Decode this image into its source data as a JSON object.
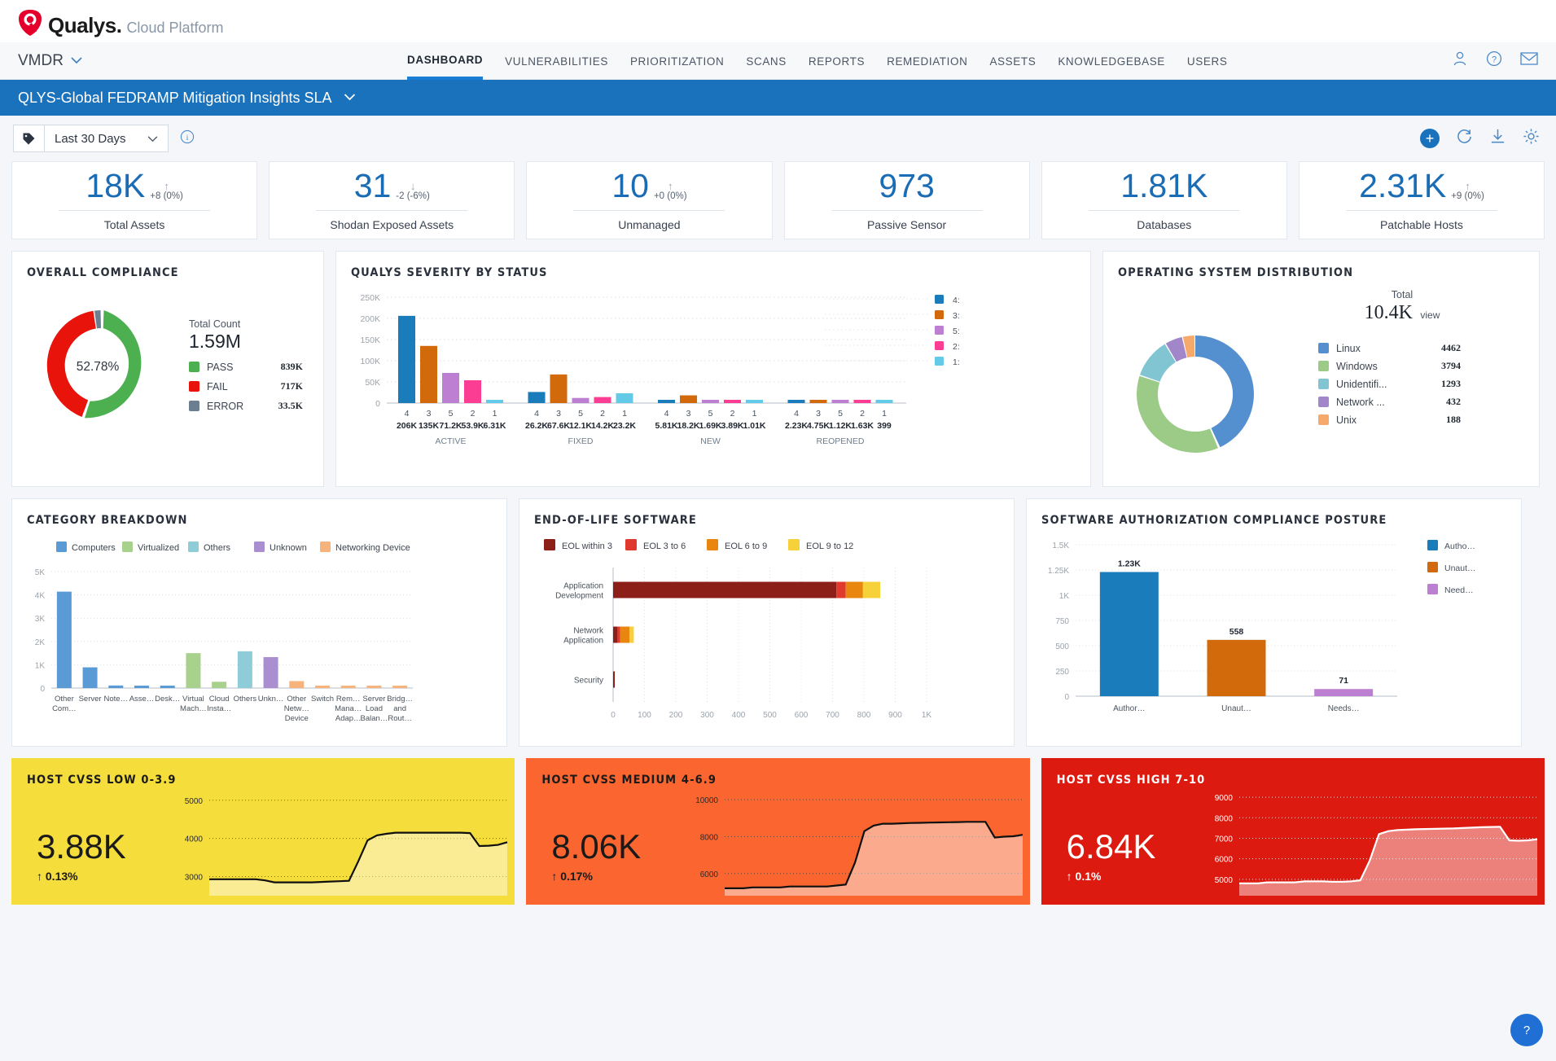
{
  "brand": {
    "name": "Qualys.",
    "suffix": "Cloud Platform"
  },
  "module": {
    "name": "VMDR"
  },
  "nav": {
    "items": [
      {
        "label": "DASHBOARD",
        "active": true
      },
      {
        "label": "VULNERABILITIES",
        "active": false
      },
      {
        "label": "PRIORITIZATION",
        "active": false
      },
      {
        "label": "SCANS",
        "active": false
      },
      {
        "label": "REPORTS",
        "active": false
      },
      {
        "label": "REMEDIATION",
        "active": false
      },
      {
        "label": "ASSETS",
        "active": false
      },
      {
        "label": "KNOWLEDGEBASE",
        "active": false
      },
      {
        "label": "USERS",
        "active": false
      }
    ],
    "icons": [
      "user-icon",
      "help-icon",
      "mail-icon"
    ]
  },
  "dashboard_bar": {
    "title": "QLYS-Global FEDRAMP Mitigation Insights SLA"
  },
  "toolbar": {
    "tag_icon": "tag-icon",
    "range_value": "Last 30 Days",
    "info_icon": "info-icon",
    "add_label": "+",
    "refresh_icon": "refresh-icon",
    "download_icon": "download-icon",
    "settings_icon": "gear-icon"
  },
  "kpis": [
    {
      "value": "18K",
      "delta": "+8 (0%)",
      "dir": "up",
      "label": "Total Assets"
    },
    {
      "value": "31",
      "delta": "-2 (-6%)",
      "dir": "down",
      "label": "Shodan Exposed Assets"
    },
    {
      "value": "10",
      "delta": "+0 (0%)",
      "dir": "up",
      "label": "Unmanaged"
    },
    {
      "value": "973",
      "delta": "",
      "dir": "",
      "label": "Passive Sensor"
    },
    {
      "value": "1.81K",
      "delta": "",
      "dir": "",
      "label": "Databases"
    },
    {
      "value": "2.31K",
      "delta": "+9 (0%)",
      "dir": "up",
      "label": "Patchable Hosts"
    }
  ],
  "overall_compliance": {
    "title": "OVERALL COMPLIANCE",
    "center_label": "52.78%",
    "total_label": "Total Count",
    "total_value": "1.59M",
    "chart_data": {
      "type": "pie",
      "title": "Overall Compliance",
      "categories": [
        "PASS",
        "FAIL",
        "ERROR"
      ],
      "values": [
        839000,
        717000,
        33500
      ],
      "value_labels": [
        "839K",
        "717K",
        "33.5K"
      ],
      "colors": [
        "#4caf50",
        "#e8130b",
        "#6b7f91"
      ],
      "center_percent": 52.78,
      "total": 1590000,
      "legend_position": "right"
    }
  },
  "severity_by_status": {
    "title": "QUALYS SEVERITY BY STATUS",
    "chart_data": {
      "type": "bar",
      "title": "Qualys Severity By Status",
      "xlabel": "",
      "ylabel": "",
      "ylim": [
        0,
        250000
      ],
      "yticks": [
        "0",
        "50K",
        "100K",
        "150K",
        "200K",
        "250K"
      ],
      "grid": true,
      "legend_position": "right",
      "legend": [
        "4:",
        "3:",
        "5:",
        "2:",
        "1:"
      ],
      "colors": [
        "#1a7cba",
        "#d2690a",
        "#bd7fd1",
        "#fb3e93",
        "#63cbe8"
      ],
      "groups": [
        {
          "name": "ACTIVE",
          "severities": [
            "4",
            "3",
            "5",
            "2",
            "1"
          ],
          "labels": [
            "206K",
            "135K",
            "71.2K",
            "53.9K",
            "6.31K"
          ],
          "values": [
            206000,
            135000,
            71200,
            53900,
            6310
          ]
        },
        {
          "name": "FIXED",
          "severities": [
            "4",
            "3",
            "5",
            "2",
            "1"
          ],
          "labels": [
            "26.2K",
            "67.6K",
            "12.1K",
            "14.2K",
            "23.2K"
          ],
          "values": [
            26200,
            67600,
            12100,
            14200,
            23200
          ]
        },
        {
          "name": "NEW",
          "severities": [
            "4",
            "3",
            "5",
            "2",
            "1"
          ],
          "labels": [
            "5.81K",
            "18.2K",
            "1.69K",
            "3.89K",
            "1.01K"
          ],
          "values": [
            5810,
            18200,
            1690,
            3890,
            1010
          ]
        },
        {
          "name": "REOPENED",
          "severities": [
            "4",
            "3",
            "5",
            "2",
            "1"
          ],
          "labels": [
            "2.23K",
            "4.75K",
            "1.12K",
            "1.63K",
            "399"
          ],
          "values": [
            2230,
            4750,
            1120,
            1630,
            399
          ]
        }
      ]
    }
  },
  "os_distribution": {
    "title": "OPERATING SYSTEM DISTRIBUTION",
    "total_label": "Total",
    "total_value": "10.4K",
    "view_label": "view",
    "chart_data": {
      "type": "pie",
      "title": "Operating System Distribution",
      "categories": [
        "Linux",
        "Windows",
        "Unidentifi...",
        "Network ...",
        "Unix"
      ],
      "values": [
        4462,
        3794,
        1293,
        432,
        188
      ],
      "value_labels": [
        "4462",
        "3794",
        "1293",
        "432",
        "188"
      ],
      "colors": [
        "#548fd0",
        "#9ccb87",
        "#81c5d3",
        "#a186c9",
        "#f5a96a"
      ],
      "total": 10400,
      "legend_position": "right"
    }
  },
  "category_breakdown": {
    "title": "CATEGORY BREAKDOWN",
    "chart_data": {
      "type": "bar",
      "title": "Category Breakdown",
      "ylim": [
        0,
        5000
      ],
      "yticks": [
        "0",
        "1K",
        "2K",
        "3K",
        "4K",
        "5K"
      ],
      "grid": true,
      "legend_position": "top",
      "series": [
        {
          "name": "Computers",
          "color": "#5b9bd5"
        },
        {
          "name": "Virtualized",
          "color": "#a9d18e"
        },
        {
          "name": "Others",
          "color": "#8ecdd8"
        },
        {
          "name": "Unknown",
          "color": "#a98fd0"
        },
        {
          "name": "Networking Device",
          "color": "#f6b47c"
        }
      ],
      "categories": [
        "Other Com…",
        "Server",
        "Note…",
        "Asse…",
        "Desk…",
        "Virtual Mach…",
        "Cloud Insta…",
        "Others",
        "Unkn…",
        "Other Netw… Device",
        "Switch",
        "Rem… Mana… Adap…",
        "Server Load Balan…",
        "Bridg… and Rout…"
      ],
      "values": [
        4140,
        890,
        110,
        105,
        105,
        1500,
        270,
        1580,
        1330,
        300,
        90,
        95,
        95,
        95
      ],
      "point_colors": [
        "#5b9bd5",
        "#5b9bd5",
        "#5b9bd5",
        "#5b9bd5",
        "#5b9bd5",
        "#a9d18e",
        "#a9d18e",
        "#8ecdd8",
        "#a98fd0",
        "#f6b47c",
        "#f6b47c",
        "#f6b47c",
        "#f6b47c",
        "#f6b47c"
      ]
    }
  },
  "eol_software": {
    "title": "END-OF-LIFE SOFTWARE",
    "chart_data": {
      "type": "bar",
      "orientation": "horizontal",
      "title": "End-Of-Life Software",
      "xlim": [
        0,
        1000
      ],
      "xticks": [
        "0",
        "100",
        "200",
        "300",
        "400",
        "500",
        "600",
        "700",
        "800",
        "900",
        "1K"
      ],
      "grid": true,
      "legend_position": "top",
      "series": [
        {
          "name": "EOL within 3",
          "color": "#8c2018",
          "values": [
            712,
            14,
            4
          ]
        },
        {
          "name": "EOL 3 to 6",
          "color": "#e03a2f",
          "values": [
            30,
            8,
            0
          ]
        },
        {
          "name": "EOL 6 to 9",
          "color": "#e8860f",
          "values": [
            55,
            30,
            0
          ]
        },
        {
          "name": "EOL 9 to 12",
          "color": "#f7d139",
          "values": [
            55,
            14,
            0
          ]
        }
      ],
      "categories": [
        "Application Development",
        "Network Application",
        "Security"
      ]
    }
  },
  "software_auth": {
    "title": "SOFTWARE AUTHORIZATION COMPLIANCE POSTURE",
    "chart_data": {
      "type": "bar",
      "title": "Software Authorization Compliance Posture",
      "ylim": [
        0,
        1500
      ],
      "yticks": [
        "0",
        "250",
        "500",
        "750",
        "1K",
        "1.25K",
        "1.5K"
      ],
      "grid": true,
      "legend_position": "right",
      "legend": [
        "Autho…",
        "Unaut…",
        "Need…"
      ],
      "categories": [
        "Author…",
        "Unaut…",
        "Needs…"
      ],
      "values": [
        1230,
        558,
        71
      ],
      "value_labels": [
        "1.23K",
        "558",
        "71"
      ],
      "colors": [
        "#1a7cba",
        "#d2690a",
        "#bd7fd1"
      ]
    }
  },
  "cvss_cards": [
    {
      "title": "HOST CVSS LOW 0-3.9",
      "value": "3.88K",
      "pct": "0.13%",
      "dir": "up",
      "bg": "#f5dd3c",
      "text": "#1a1a1a",
      "chart_data": {
        "type": "area",
        "title": "Host CVSS Low 0-3.9",
        "yticks": [
          "3000",
          "4000",
          "5000"
        ],
        "ylim": [
          2500,
          5400
        ],
        "grid": true,
        "values": [
          2930,
          2930,
          2930,
          2930,
          2930,
          2930,
          2900,
          2850,
          2850,
          2850,
          2850,
          2850,
          2860,
          2870,
          2880,
          2890,
          3400,
          3950,
          4080,
          4120,
          4150,
          4150,
          4150,
          4150,
          4150,
          4150,
          4150,
          4150,
          4140,
          3800,
          3810,
          3830,
          3900
        ]
      }
    },
    {
      "title": "HOST CVSS MEDIUM 4-6.9",
      "value": "8.06K",
      "pct": "0.17%",
      "dir": "up",
      "bg": "#fa6530",
      "text": "#1a1a1a",
      "chart_data": {
        "type": "area",
        "title": "Host CVSS Medium 4-6.9",
        "yticks": [
          "6000",
          "8000",
          "10000"
        ],
        "ylim": [
          4800,
          10800
        ],
        "grid": true,
        "values": [
          5200,
          5200,
          5200,
          5250,
          5250,
          5250,
          5250,
          5300,
          5300,
          5300,
          5300,
          5300,
          5350,
          5400,
          6600,
          8300,
          8600,
          8700,
          8700,
          8720,
          8740,
          8750,
          8760,
          8770,
          8780,
          8790,
          8800,
          8800,
          8800,
          7950,
          8000,
          8020,
          8100
        ]
      }
    },
    {
      "title": "HOST CVSS HIGH 7-10",
      "value": "6.84K",
      "pct": "0.1%",
      "dir": "up",
      "bg": "#dd1a0f",
      "text": "#ffffff",
      "chart_data": {
        "type": "area",
        "title": "Host CVSS High 7-10",
        "yticks": [
          "5000",
          "6000",
          "7000",
          "8000",
          "9000"
        ],
        "ylim": [
          4200,
          9600
        ],
        "grid": true,
        "values": [
          4800,
          4800,
          4800,
          4850,
          4850,
          4850,
          4850,
          4900,
          4900,
          4900,
          4880,
          4880,
          4900,
          4950,
          5900,
          7200,
          7350,
          7400,
          7420,
          7440,
          7450,
          7460,
          7470,
          7480,
          7500,
          7520,
          7540,
          7550,
          7560,
          6900,
          6880,
          6900,
          6950
        ]
      }
    }
  ],
  "help_fab": {
    "icon": "help-icon"
  }
}
